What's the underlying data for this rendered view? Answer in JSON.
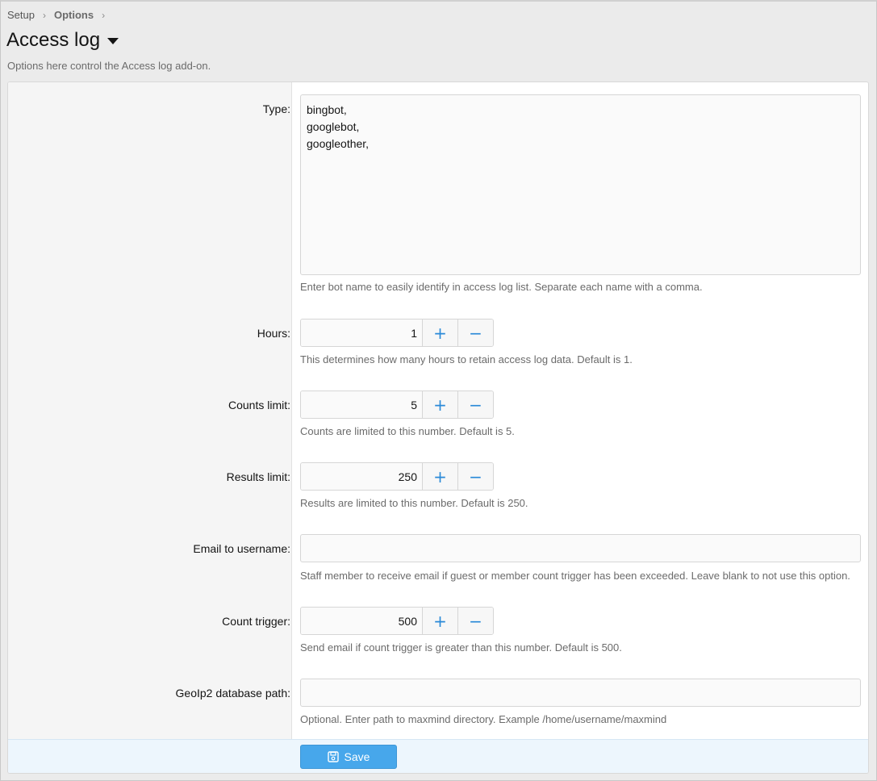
{
  "breadcrumb": {
    "items": [
      "Setup",
      "Options"
    ]
  },
  "page": {
    "title": "Access log",
    "description": "Options here control the Access log add-on."
  },
  "form": {
    "type": {
      "label": "Type:",
      "value": "bingbot,\ngooglebot,\ngoogleother,",
      "hint": "Enter bot name to easily identify in access log list. Separate each name with a comma."
    },
    "hours": {
      "label": "Hours:",
      "value": "1",
      "hint": "This determines how many hours to retain access log data. Default is 1."
    },
    "counts_limit": {
      "label": "Counts limit:",
      "value": "5",
      "hint": "Counts are limited to this number. Default is 5."
    },
    "results_limit": {
      "label": "Results limit:",
      "value": "250",
      "hint": "Results are limited to this number. Default is 250."
    },
    "email_username": {
      "label": "Email to username:",
      "value": "",
      "hint": "Staff member to receive email if guest or member count trigger has been exceeded. Leave blank to not use this option."
    },
    "count_trigger": {
      "label": "Count trigger:",
      "value": "500",
      "hint": "Send email if count trigger is greater than this number. Default is 500."
    },
    "geoip_path": {
      "label": "GeoIp2 database path:",
      "value": "",
      "hint": "Optional. Enter path to maxmind directory. Example /home/username/maxmind"
    },
    "stepper": {
      "plus": "+",
      "minus": "−"
    },
    "save_label": "Save"
  },
  "icons": {
    "save": "save-icon",
    "dropdown": "caret-down-icon"
  },
  "colors": {
    "accent": "#47a7eb",
    "stepper_glyph": "#2b8ad8",
    "footer_bg": "#edf6fd"
  }
}
